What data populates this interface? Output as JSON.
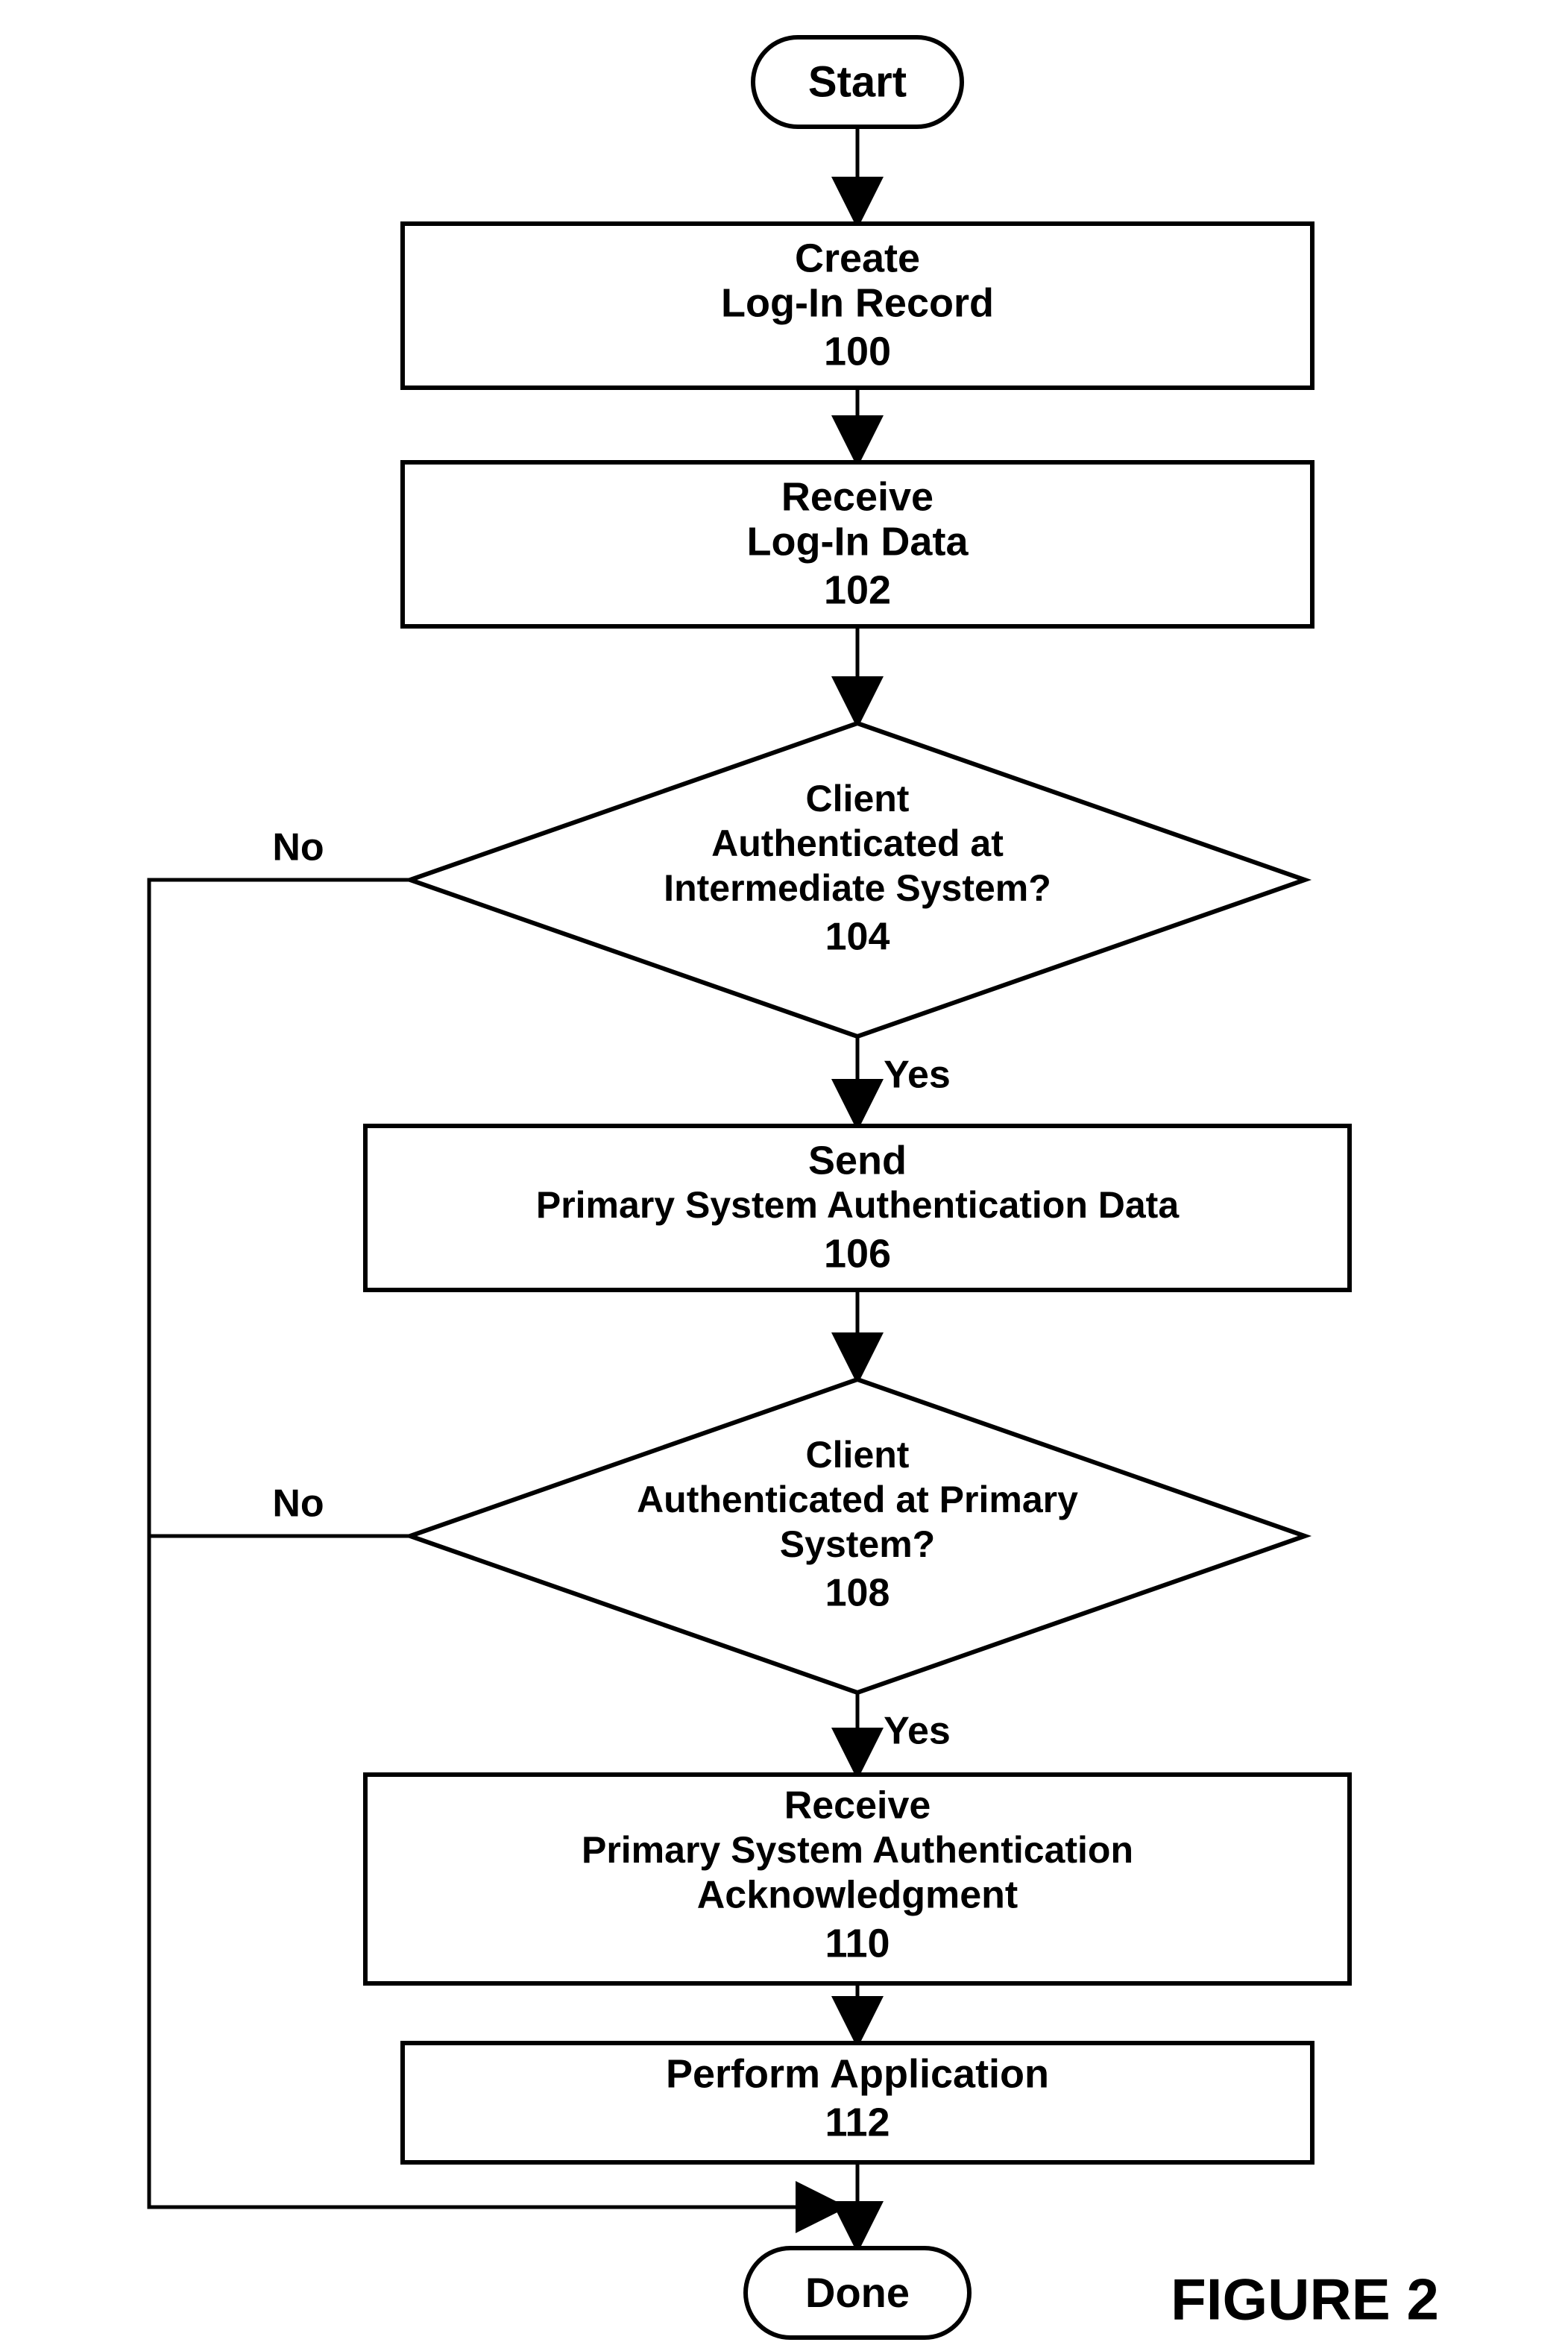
{
  "figure_label": "FIGURE 2",
  "start": "Start",
  "done": "Done",
  "step100": {
    "l1": "Create",
    "l2": "Log-In Record",
    "num": "100"
  },
  "step102": {
    "l1": "Receive",
    "l2": "Log-In Data",
    "num": "102"
  },
  "dec104": {
    "l1": "Client",
    "l2": "Authenticated at",
    "l3": "Intermediate System?",
    "num": "104",
    "no": "No",
    "yes": "Yes"
  },
  "step106": {
    "l1": "Send",
    "l2": "Primary System Authentication Data",
    "num": "106"
  },
  "dec108": {
    "l1": "Client",
    "l2": "Authenticated at Primary",
    "l3": "System?",
    "num": "108",
    "no": "No",
    "yes": "Yes"
  },
  "step110": {
    "l1": "Receive",
    "l2": "Primary System Authentication",
    "l3": "Acknowledgment",
    "num": "110"
  },
  "step112": {
    "l1": "Perform Application",
    "num": "112"
  }
}
